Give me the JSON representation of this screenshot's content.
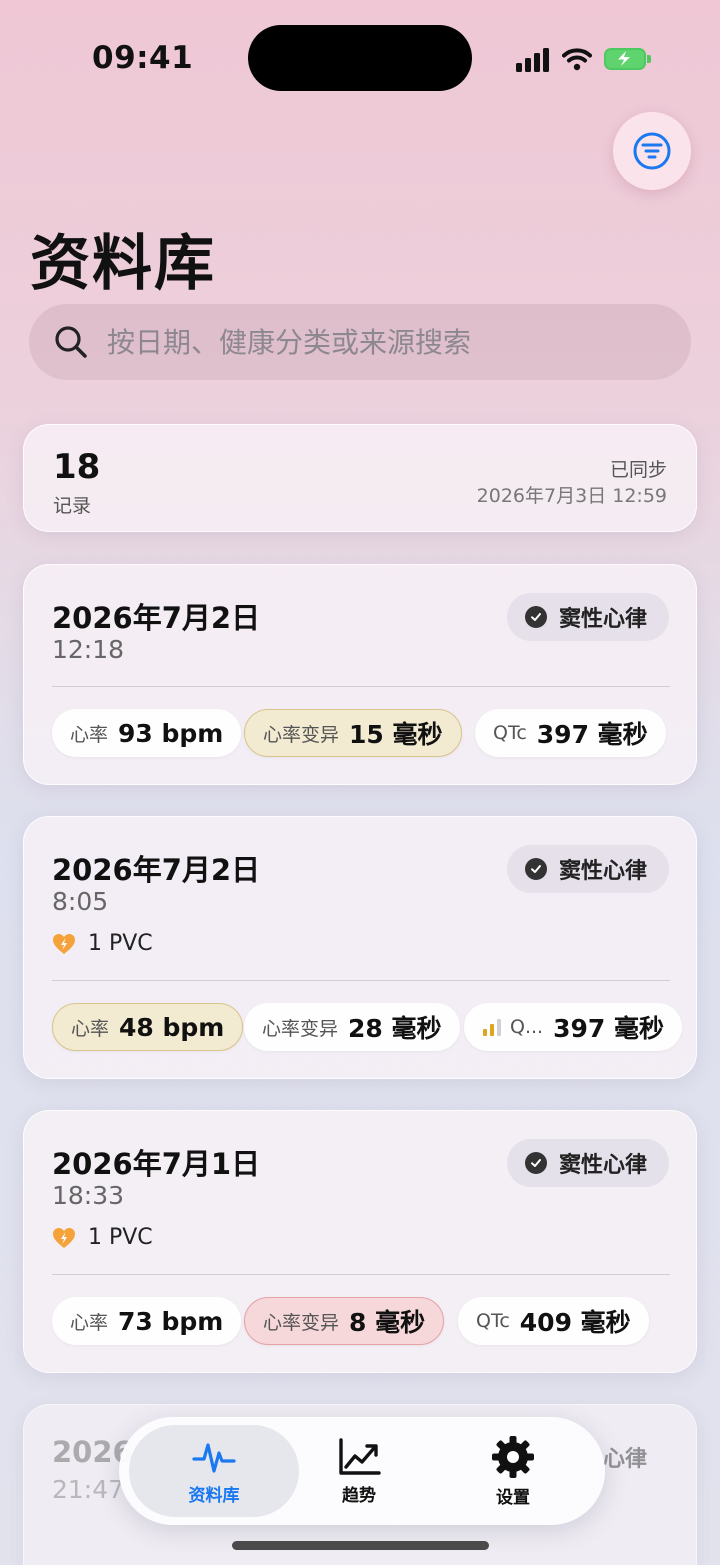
{
  "status_bar": {
    "time": "09:41"
  },
  "header": {
    "title": "资料库",
    "filter_icon": "filter-lines-icon"
  },
  "search": {
    "placeholder": "按日期、健康分类或来源搜索",
    "value": ""
  },
  "summary": {
    "count": "18",
    "count_label": "记录",
    "sync_status": "已同步",
    "sync_time": "2026年7月3日 12:59"
  },
  "records": [
    {
      "date": "2026年7月2日",
      "time": "12:18",
      "rhythm": "窦性心律",
      "metrics": [
        {
          "label": "心率",
          "value": "93 bpm",
          "state": "normal"
        },
        {
          "label": "心率变异",
          "value": "15 毫秒",
          "state": "warn"
        },
        {
          "label": "QTc",
          "value": "397 毫秒",
          "state": "normal"
        }
      ]
    },
    {
      "date": "2026年7月2日",
      "time": "8:05",
      "rhythm": "窦性心律",
      "pvc": "1 PVC",
      "metrics": [
        {
          "label": "心率",
          "value": "48 bpm",
          "state": "warn"
        },
        {
          "label": "心率变异",
          "value": "28 毫秒",
          "state": "normal"
        },
        {
          "label": "Q...",
          "value": "397 毫秒",
          "state": "normal"
        }
      ]
    },
    {
      "date": "2026年7月1日",
      "time": "18:33",
      "rhythm": "窦性心律",
      "pvc": "1 PVC",
      "metrics": [
        {
          "label": "心率",
          "value": "73 bpm",
          "state": "normal"
        },
        {
          "label": "心率变异",
          "value": "8 毫秒",
          "state": "alert"
        },
        {
          "label": "QTc",
          "value": "409 毫秒",
          "state": "normal"
        }
      ]
    },
    {
      "date": "2026",
      "time": "21:47",
      "rhythm": "心律"
    }
  ],
  "tabs": [
    {
      "label": "资料库",
      "icon": "waveform-icon",
      "active": true
    },
    {
      "label": "趋势",
      "icon": "chart-line-icon",
      "active": false
    },
    {
      "label": "设置",
      "icon": "gear-icon",
      "active": false
    }
  ],
  "colors": {
    "accent": "#1a78f0",
    "pvc_orange": "#f5a23a",
    "battery_green": "#4cc95f",
    "warn_bg": "#f3ead2",
    "alert_bg": "#f7d8da"
  }
}
